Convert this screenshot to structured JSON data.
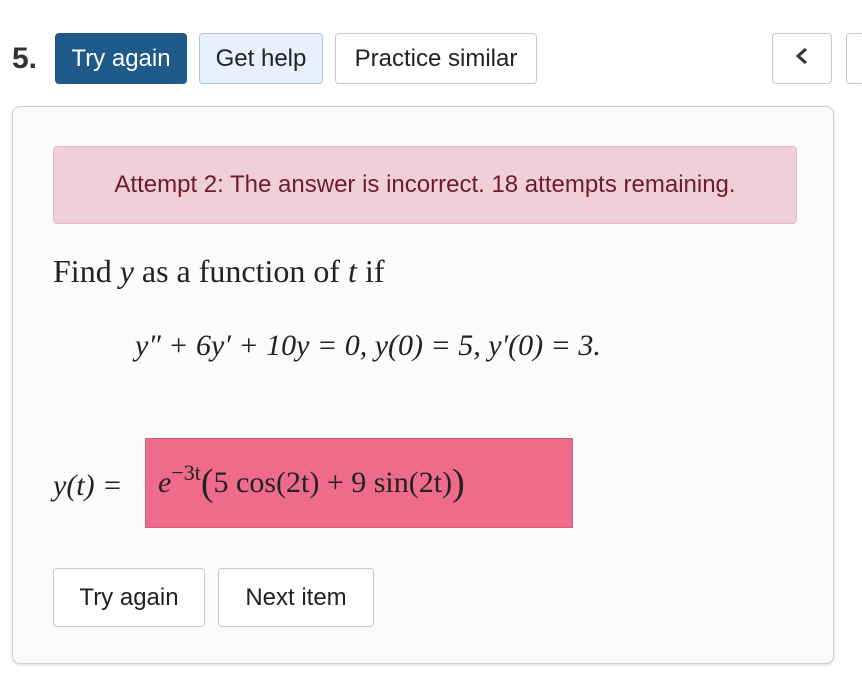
{
  "question": {
    "number": "5."
  },
  "toolbar": {
    "try_again_label": "Try again",
    "get_help_label": "Get help",
    "practice_similar_label": "Practice similar",
    "prev_glyph": "<"
  },
  "alert": {
    "message": "Attempt 2: The answer is incorrect. 18 attempts remaining."
  },
  "problem": {
    "prompt_prefix": "Find ",
    "prompt_var": "y",
    "prompt_middle": " as a function of ",
    "prompt_var2": "t",
    "prompt_suffix": " if",
    "equation": "y″ + 6y′ + 10y = 0,    y(0) = 5,    y′(0) = 3."
  },
  "answer": {
    "label": "y(t) =",
    "base": "e",
    "exponent": "−3t",
    "open_paren": "(",
    "body": "5 cos(2t) + 9 sin(2t)",
    "close_paren": ")"
  },
  "actions": {
    "try_again_label": "Try again",
    "next_item_label": "Next item"
  },
  "colors": {
    "primary": "#1f5a8a",
    "alert_bg": "#f0d0d8",
    "alert_text": "#6e1a2c",
    "incorrect_answer_bg": "#ee6b8a"
  }
}
